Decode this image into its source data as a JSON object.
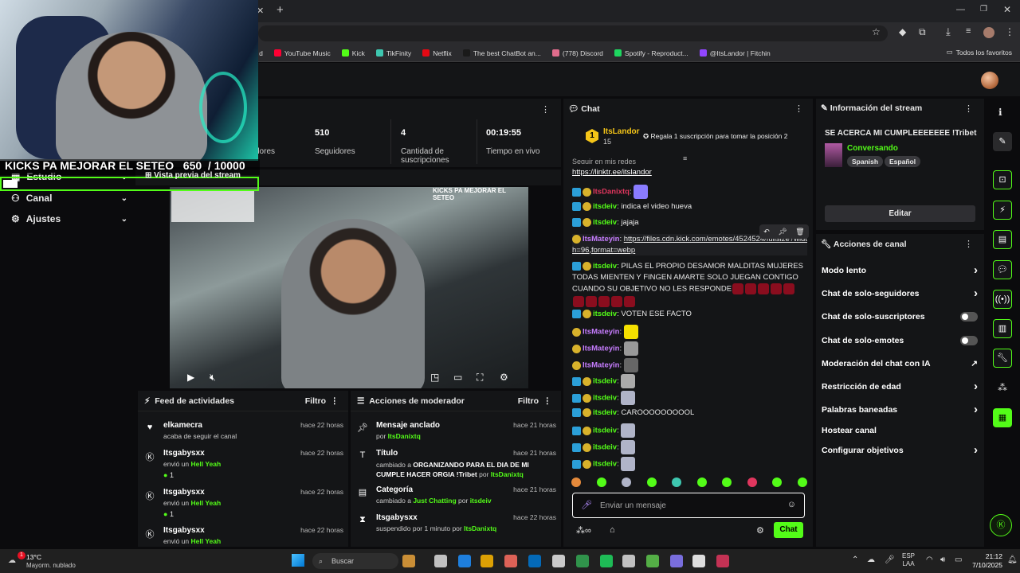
{
  "browser": {
    "bookmarks": [
      {
        "label": "o d",
        "color": "#888888"
      },
      {
        "label": "YouTube Music",
        "color": "#ff0033"
      },
      {
        "label": "Kick",
        "color": "#53fc18"
      },
      {
        "label": "TikFinity",
        "color": "#3ec7b0"
      },
      {
        "label": "Netflix",
        "color": "#e50914"
      },
      {
        "label": "The best ChatBot an...",
        "color": "#1a1a1a"
      },
      {
        "label": "(778) Discord",
        "color": "#e06c8c"
      },
      {
        "label": "Spotify - Reproduct...",
        "color": "#1ed760"
      },
      {
        "label": "@ItsLandor | Fitchin",
        "color": "#9146ff"
      }
    ],
    "all_favorites": "Todos los favoritos"
  },
  "overlay": {
    "goal_title": "KICKS PA MEJORAR EL SETEO",
    "goal_current": "650",
    "goal_total": "/ 10000"
  },
  "nav": {
    "estudio": "Estudio",
    "preview_label": "Vista previa del stream",
    "canal": "Canal",
    "ajustes": "Ajustes"
  },
  "stats": {
    "followers_label_partial": "dores",
    "followers_value": "510",
    "followers_label": "Seguidores",
    "subs_value": "4",
    "subs_label": "Cantidad de suscripciones",
    "live_value": "00:19:55",
    "live_label": "Tiempo en vivo"
  },
  "activity": {
    "title": "Feed de actividades",
    "filter": "Filtro",
    "items": [
      {
        "name": "elkamecra",
        "time": "hace 22 horas",
        "line": "acaba de seguir el canal",
        "icon": "heart-icon"
      },
      {
        "name": "Itsgabysxx",
        "time": "hace 22 horas",
        "pre": "envió un",
        "item": "Hell Yeah",
        "count": "1",
        "icon": "kick-icon"
      },
      {
        "name": "Itsgabysxx",
        "time": "hace 22 horas",
        "pre": "envió un",
        "item": "Hell Yeah",
        "count": "1",
        "icon": "kick-icon"
      },
      {
        "name": "Itsgabysxx",
        "time": "hace 22 horas",
        "pre": "envió un",
        "item": "Hell Yeah",
        "icon": "kick-icon"
      }
    ]
  },
  "modactions": {
    "title": "Acciones de moderador",
    "filter": "Filtro",
    "items": [
      {
        "title": "Mensaje anclado",
        "time": "hace 21 horas",
        "pre": "por",
        "user": "ItsDanixtq"
      },
      {
        "title": "Título",
        "time": "hace 21 horas",
        "pre": "cambiado a",
        "value": "ORGANIZANDO PARA EL DIA DE MI CUMPLE HACER ORGIA !Tribet",
        "mid": "por",
        "user": "ItsDanixtq"
      },
      {
        "title": "Categoría",
        "time": "hace 21 horas",
        "pre": "cambiado a",
        "value": "Just Chatting",
        "mid": "por",
        "user": "itsdeiv"
      },
      {
        "title": "Itsgabysxx",
        "time": "hace 22 horas",
        "pre": "suspendido por 1 minuto por",
        "user": "ItsDanixtq"
      }
    ]
  },
  "chat": {
    "title": "Chat",
    "top_user": "ItsLandor",
    "top_rank": "1",
    "top_amount": "15",
    "gift_text": "Regala 1 suscripción para tomar la posición 2",
    "partial_line": "Seguir en mis redes",
    "link1": "https://linktr.ee/itslandor",
    "messages": [
      {
        "user": "ItsDanixtq",
        "color": "#e0365e",
        "text": ""
      },
      {
        "user": "itsdeiv",
        "color": "#53fc18",
        "text": "indica el video hueva"
      },
      {
        "user": "itsdeiv",
        "color": "#53fc18",
        "text": "jajaja"
      },
      {
        "user": "ItsMateyin",
        "color": "#c77dff",
        "text": "https://files.cdn.kick.com/emotes/4524524/fullsize?width=96,format=webp"
      },
      {
        "user": "itsdeiv",
        "color": "#53fc18",
        "text": "PILAS EL PROPIO DESAMOR MALDITAS MUJERES TODAS MIENTEN Y FINGEN AMARTE SOLO JUEGAN CONTIGO CUANDO SU OBJETIVO NO LES RESPONDE"
      },
      {
        "user": "itsdeiv",
        "color": "#53fc18",
        "text": "VOTEN ESE FACTO"
      },
      {
        "user": "ItsMateyin",
        "color": "#c77dff",
        "text": ""
      },
      {
        "user": "ItsMateyin",
        "color": "#c77dff",
        "text": ""
      },
      {
        "user": "ItsMateyin",
        "color": "#c77dff",
        "text": ""
      },
      {
        "user": "itsdeiv",
        "color": "#53fc18",
        "text": ""
      },
      {
        "user": "itsdeiv",
        "color": "#53fc18",
        "text": ""
      },
      {
        "user": "itsdeiv",
        "color": "#53fc18",
        "text": "CAROOOOOOOOOL"
      },
      {
        "user": "itsdeiv",
        "color": "#53fc18",
        "text": ""
      },
      {
        "user": "itsdeiv",
        "color": "#53fc18",
        "text": ""
      },
      {
        "user": "itsdeiv",
        "color": "#53fc18",
        "text": ""
      }
    ],
    "input_placeholder": "Enviar un mensaje",
    "send_label": "Chat"
  },
  "info": {
    "title": "Información del stream",
    "stream_title": "SE ACERCA MI CUMPLEEEEEEE !Tribet",
    "category": "Conversando",
    "tags": [
      "Spanish",
      "Español"
    ],
    "edit_label": "Editar"
  },
  "actions": {
    "title": "Acciones de canal",
    "items": [
      {
        "label": "Modo lento",
        "kind": "chevron"
      },
      {
        "label": "Chat de solo-seguidores",
        "kind": "chevron"
      },
      {
        "label": "Chat de solo-suscriptores",
        "kind": "toggle"
      },
      {
        "label": "Chat de solo-emotes",
        "kind": "toggle"
      },
      {
        "label": "Moderación del chat con IA",
        "kind": "external"
      },
      {
        "label": "Restricción de edad",
        "kind": "chevron"
      },
      {
        "label": "Palabras baneadas",
        "kind": "chevron"
      },
      {
        "label": "Hostear canal",
        "kind": "none"
      },
      {
        "label": "Configurar objetivos",
        "kind": "chevron"
      }
    ]
  },
  "taskbar": {
    "weather_temp": "13°C",
    "weather_desc": "Mayorm. nublado",
    "search_label": "Buscar",
    "lang": "ESP",
    "region": "LAA",
    "time": "21:12",
    "date": "7/10/2025",
    "weather_badge": "1"
  }
}
